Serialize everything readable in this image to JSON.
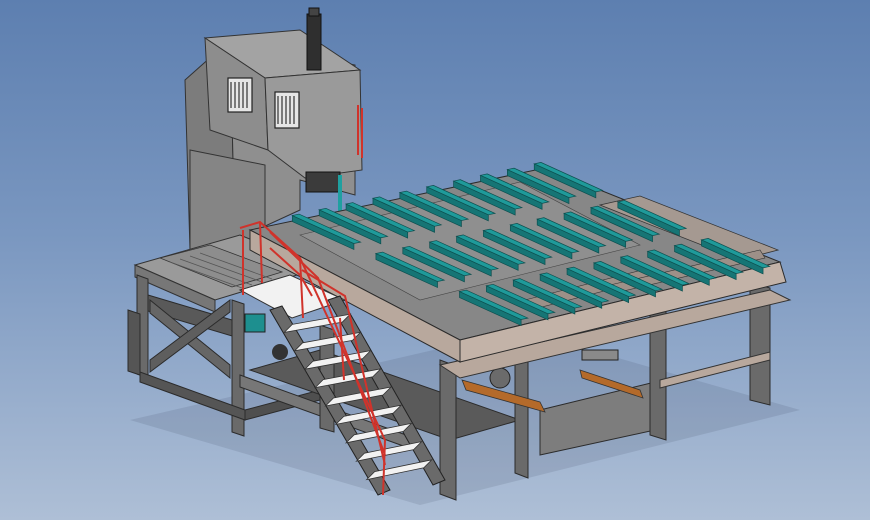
{
  "scene": {
    "subject": "vertical-band-saw-with-stair-platform",
    "colors": {
      "background_top": "#5d7fb0",
      "background_bottom": "#aebfd6",
      "housing": "#8c8c8c",
      "housing_dark": "#6e6e6e",
      "frame_steel": "#6a6a6a",
      "frame_steel_dark": "#4a4a4a",
      "deck_top": "#8a8a8a",
      "deck_edge": "#b6a59a",
      "rollers": "#1f9a9a",
      "roller_side": "#167575",
      "handrail": "#d0332b",
      "stair_tread": "#f2f2f2",
      "accent_orange": "#e08a22"
    },
    "roller_count": 30
  }
}
